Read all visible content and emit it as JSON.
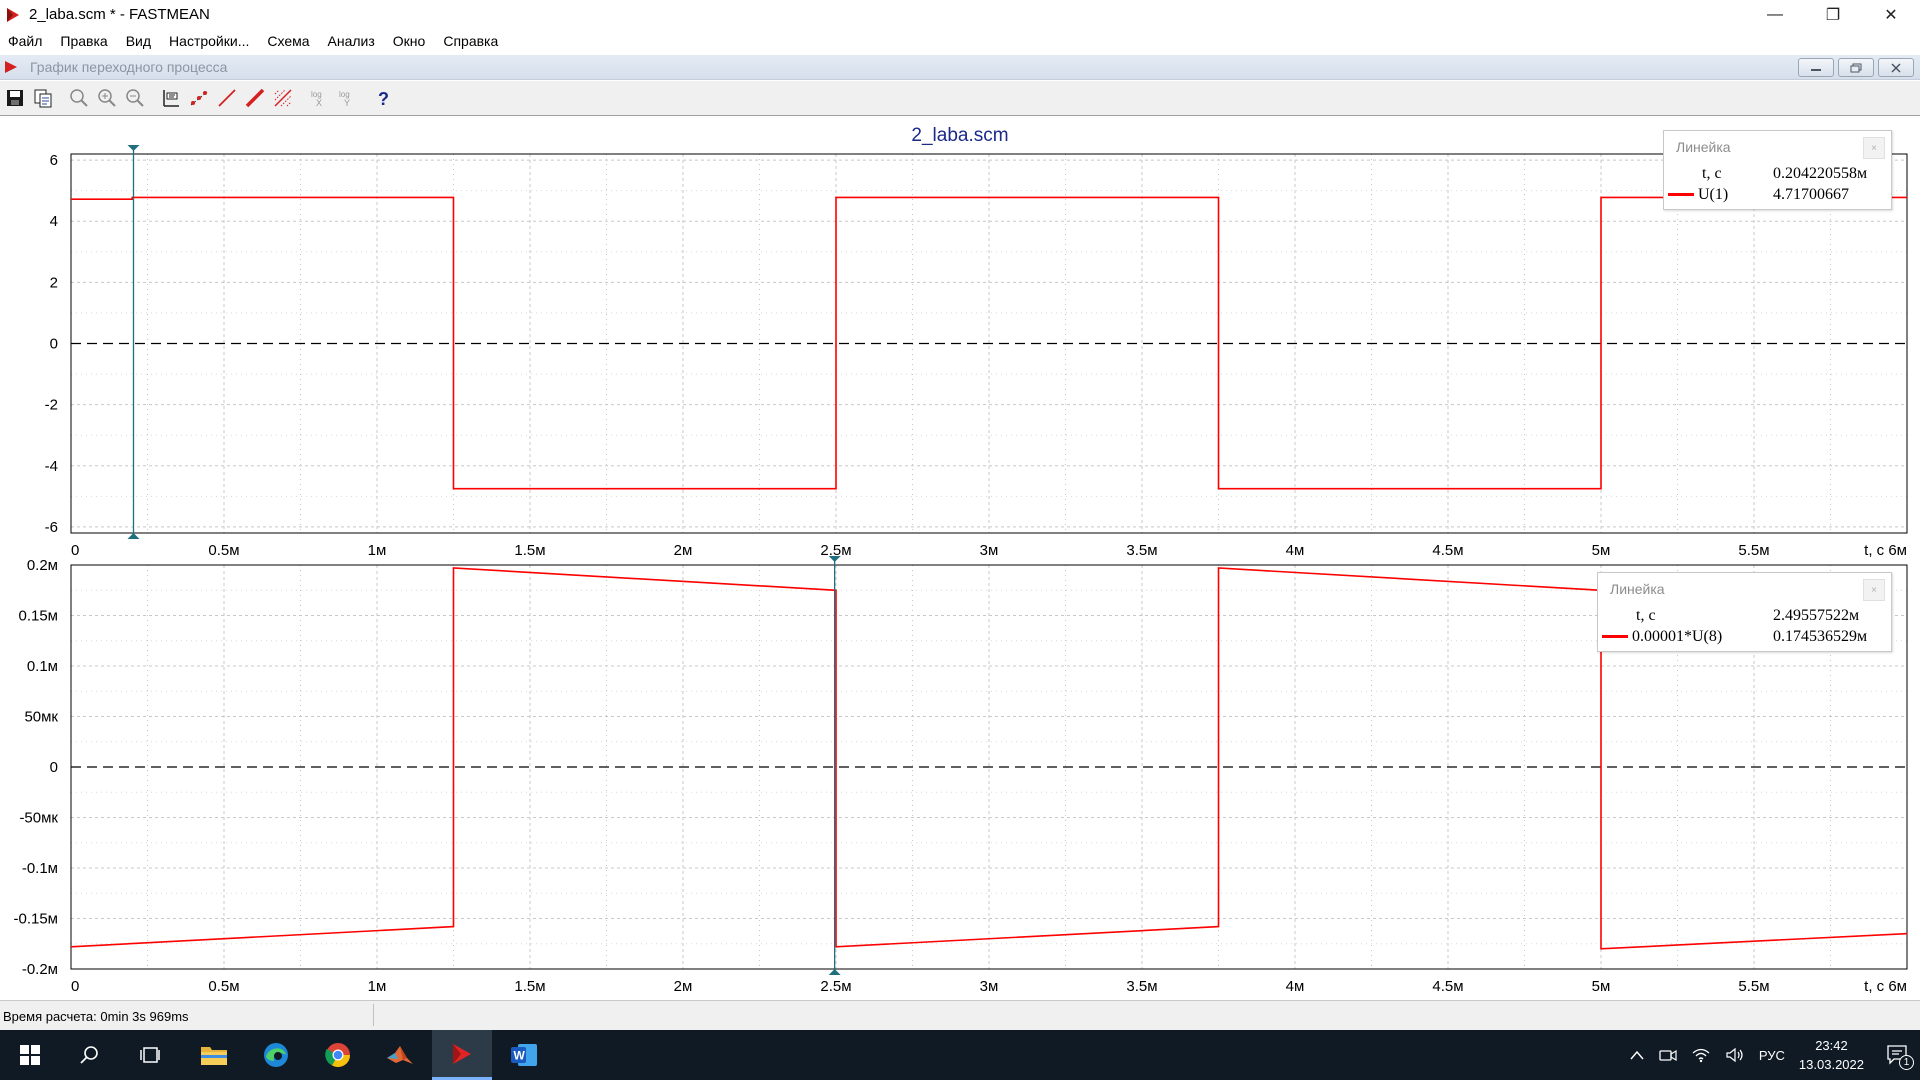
{
  "window": {
    "title": "2_laba.scm * - FASTMEAN",
    "minimize": "—",
    "restore": "❐",
    "close": "✕"
  },
  "menu": [
    "Файл",
    "Правка",
    "Вид",
    "Настройки...",
    "Схема",
    "Анализ",
    "Окно",
    "Справка"
  ],
  "child_window": {
    "title": "График переходного процесса"
  },
  "toolbar": {
    "icons": [
      "save-icon",
      "copy-icon",
      "zoom-icon",
      "zoom-in-icon",
      "zoom-out-icon",
      "ruler-icon",
      "points-icon",
      "line-icon",
      "thick-line-icon",
      "grid-icon",
      "log-x-icon",
      "log-y-icon",
      "help-icon"
    ],
    "log_label": "log",
    "log_x": "X",
    "log_y": "Y",
    "help_label": "?"
  },
  "plot": {
    "title": "2_laba.scm",
    "curve_color": "#ff0000",
    "cursor_color": "#1f6f7f",
    "top": {
      "yticks": [
        {
          "v": 6,
          "label": "6"
        },
        {
          "v": 4,
          "label": "4"
        },
        {
          "v": 2,
          "label": "2"
        },
        {
          "v": 0,
          "label": "0"
        },
        {
          "v": -2,
          "label": "-2"
        },
        {
          "v": -4,
          "label": "-4"
        },
        {
          "v": -6,
          "label": "-6"
        }
      ],
      "ylim": [
        -6.2,
        6.2
      ],
      "cursor_t": 0.204220558
    },
    "bottom": {
      "yticks": [
        {
          "v": 0.2,
          "label": "0.2м"
        },
        {
          "v": 0.15,
          "label": "0.15м"
        },
        {
          "v": 0.1,
          "label": "0.1м"
        },
        {
          "v": 0.05,
          "label": "50мк"
        },
        {
          "v": 0,
          "label": "0"
        },
        {
          "v": -0.05,
          "label": "-50мк"
        },
        {
          "v": -0.1,
          "label": "-0.1м"
        },
        {
          "v": -0.15,
          "label": "-0.15м"
        },
        {
          "v": -0.2,
          "label": "-0.2м"
        }
      ],
      "ylim": [
        -0.2,
        0.2
      ],
      "cursor_t": 2.49557522
    },
    "xticks": [
      {
        "v": 0,
        "label": "0"
      },
      {
        "v": 0.5,
        "label": "0.5м"
      },
      {
        "v": 1,
        "label": "1м"
      },
      {
        "v": 1.5,
        "label": "1.5м"
      },
      {
        "v": 2,
        "label": "2м"
      },
      {
        "v": 2.5,
        "label": "2.5м"
      },
      {
        "v": 3,
        "label": "3м"
      },
      {
        "v": 3.5,
        "label": "3.5м"
      },
      {
        "v": 4,
        "label": "4м"
      },
      {
        "v": 4.5,
        "label": "4.5м"
      },
      {
        "v": 5,
        "label": "5м"
      },
      {
        "v": 5.5,
        "label": "5.5м"
      },
      {
        "v": 6,
        "label": "t, с  6м"
      }
    ],
    "xlim": [
      0,
      6
    ]
  },
  "chart_data": [
    {
      "type": "line",
      "title": "2_laba.scm",
      "xlabel": "t, с",
      "ylabel": "",
      "xlim": [
        0,
        6
      ],
      "ylim": [
        -6,
        6
      ],
      "grid": true,
      "legend": "top-right",
      "series": [
        {
          "name": "U(1)",
          "x": [
            0,
            0.2,
            0.2,
            1.25,
            1.25,
            2.5,
            2.5,
            3.75,
            3.75,
            5,
            5,
            6
          ],
          "y": [
            4.72,
            4.72,
            4.78,
            4.78,
            -4.75,
            -4.75,
            4.78,
            4.78,
            -4.75,
            -4.75,
            4.78,
            4.78
          ]
        }
      ]
    },
    {
      "type": "line",
      "title": "",
      "xlabel": "t, с",
      "ylabel": "",
      "xlim": [
        0,
        6
      ],
      "ylim": [
        -0.2,
        0.2
      ],
      "grid": true,
      "legend": "top-right",
      "series": [
        {
          "name": "0.00001*U(8)",
          "x": [
            0,
            1.25,
            1.25,
            2.5,
            2.5,
            3.75,
            3.75,
            5,
            5,
            6
          ],
          "y": [
            -0.178,
            -0.158,
            0.197,
            0.175,
            -0.178,
            -0.158,
            0.197,
            0.175,
            -0.18,
            -0.165
          ]
        }
      ]
    }
  ],
  "rulers": {
    "top": {
      "title": "Линейка",
      "close": "×",
      "t_label": "t, c",
      "t_value": "0.204220558м",
      "series_label": "U(1)",
      "series_value": "4.71700667"
    },
    "bottom": {
      "title": "Линейка",
      "close": "×",
      "t_label": "t, c",
      "t_value": "2.49557522м",
      "series_label": "0.00001*U(8)",
      "series_value": "0.174536529м"
    }
  },
  "status": {
    "text": "Время расчета: 0min 3s 969ms"
  },
  "taskbar": {
    "apps": [
      "windows-start-icon",
      "search-icon",
      "task-view-icon",
      "file-explorer-icon",
      "edge-icon",
      "chrome-icon",
      "matlab-icon",
      "fastmean-icon",
      "word-icon"
    ],
    "word_letter": "W",
    "language": "РУС",
    "time": "23:42",
    "date": "13.03.2022",
    "notification_count": "1"
  }
}
